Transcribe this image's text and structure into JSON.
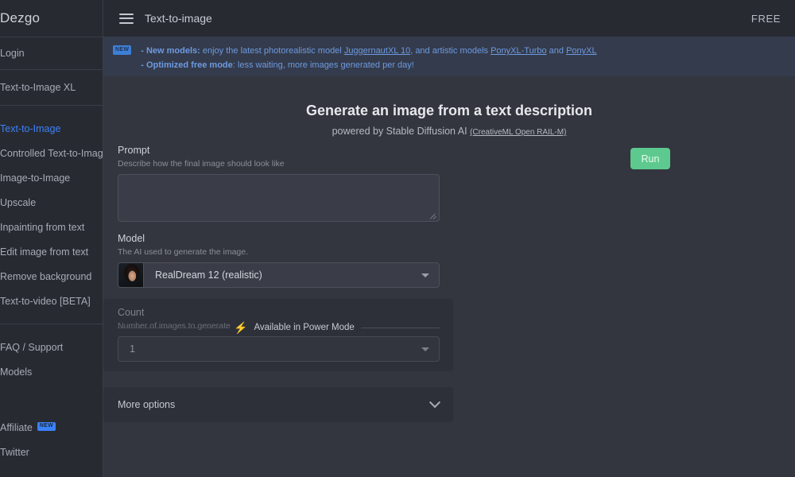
{
  "brand": "Dezgo",
  "header": {
    "menu_icon": "hamburger-icon",
    "title": "Text-to-image",
    "free_label": "FREE"
  },
  "sidebar": {
    "login": "Login",
    "groups": [
      {
        "items": [
          {
            "label": "Text-to-Image XL",
            "active": false
          }
        ]
      },
      {
        "items": [
          {
            "label": "Text-to-Image",
            "active": true
          },
          {
            "label": "Controlled Text-to-Image",
            "active": false
          },
          {
            "label": "Image-to-Image",
            "active": false
          },
          {
            "label": "Upscale",
            "active": false
          },
          {
            "label": "Inpainting from text",
            "active": false
          },
          {
            "label": "Edit image from text",
            "active": false
          },
          {
            "label": "Remove background",
            "active": false
          },
          {
            "label": "Text-to-video [BETA]",
            "active": false
          }
        ]
      },
      {
        "items": [
          {
            "label": "FAQ / Support",
            "active": false
          },
          {
            "label": "Models",
            "active": false
          }
        ]
      }
    ],
    "footer_items": [
      {
        "label": "Affiliate",
        "badge": "NEW"
      },
      {
        "label": "Twitter",
        "badge": ""
      }
    ]
  },
  "banner": {
    "badge": "NEW",
    "line1": {
      "bold": "- New models:",
      "text_a": " enjoy the latest photorealistic model ",
      "link_a": "JuggernautXL 10",
      "text_b": ", and artistic models ",
      "link_b": "PonyXL-Turbo",
      "text_c": " and ",
      "link_c": "PonyXL"
    },
    "line2": {
      "bold": "- Optimized free mode",
      "text": ": less waiting, more images generated per day!"
    }
  },
  "main": {
    "title": "Generate an image from a text description",
    "subtitle": "powered by Stable Diffusion AI",
    "license_link": "(CreativeML Open RAIL-M)",
    "run_label": "Run",
    "prompt": {
      "label": "Prompt",
      "help": "Describe how the final image should look like",
      "value": "",
      "placeholder": ""
    },
    "model": {
      "label": "Model",
      "help": "The AI used to generate the image.",
      "value": "RealDream 12 (realistic)",
      "thumb": "model-thumbnail"
    },
    "count": {
      "label": "Count",
      "help": "Number of images to generate",
      "value": "1",
      "overlay_icon": "lightning-bolt-icon",
      "overlay_text": "Available in Power Mode"
    },
    "more_options": {
      "label": "More options",
      "chevron": "chevron-down-icon"
    }
  },
  "colors": {
    "accent_green": "#5ec98e",
    "accent_blue": "#3b82f6",
    "banner_bg": "#343b4c",
    "sidebar_bg": "#282a32",
    "main_bg": "#33353f"
  }
}
